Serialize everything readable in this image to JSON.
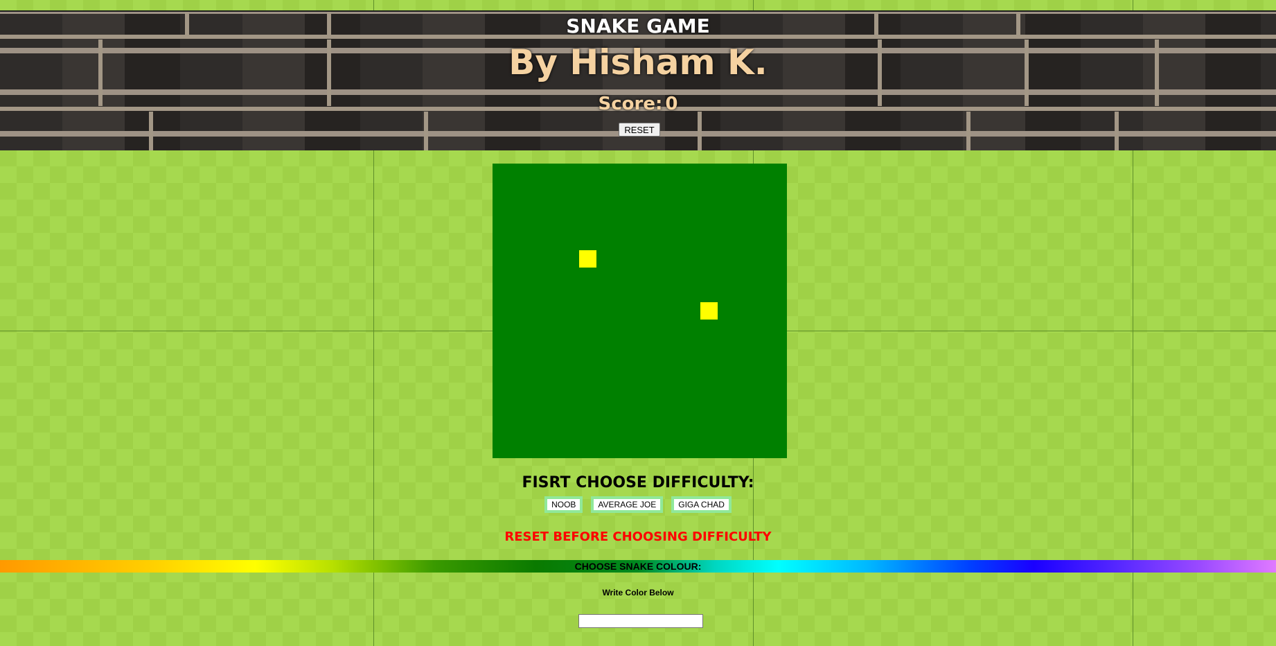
{
  "header": {
    "title": "SNAKE GAME",
    "author": "By Hisham K.",
    "score_label": "Score:",
    "score_value": "0",
    "reset_label": "RESET"
  },
  "board": {
    "background_color": "#008000",
    "food_color": "#ffff00"
  },
  "difficulty": {
    "title": "FISRT CHOOSE DIFFICULTY:",
    "options": [
      "NOOB",
      "AVERAGE JOE",
      "GIGA CHAD"
    ]
  },
  "warning": {
    "text": "RESET BEFORE CHOOSING DIFFICULTY",
    "color": "#ff0000"
  },
  "colour_picker": {
    "label": "CHOOSE SNAKE COLOUR:",
    "hint": "Write Color Below",
    "input_value": "",
    "input_placeholder": ""
  }
}
